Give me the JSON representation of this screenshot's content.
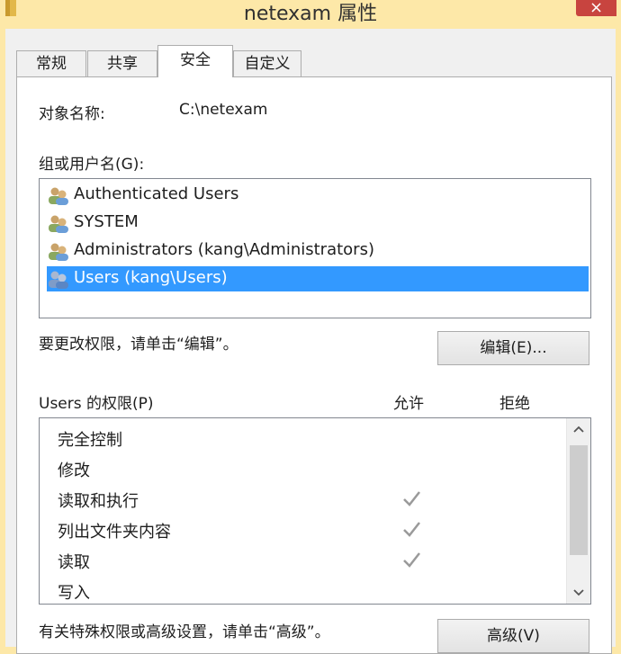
{
  "window": {
    "title": "netexam 属性",
    "close_glyph": "×"
  },
  "tabs": [
    {
      "label": "常规",
      "active": false
    },
    {
      "label": "共享",
      "active": false
    },
    {
      "label": "安全",
      "active": true
    },
    {
      "label": "自定义",
      "active": false
    }
  ],
  "object": {
    "label": "对象名称:",
    "value": "C:\\netexam"
  },
  "groups": {
    "label": "组或用户名(G):",
    "items": [
      {
        "name": "Authenticated Users",
        "selected": false
      },
      {
        "name": "SYSTEM",
        "selected": false
      },
      {
        "name": "Administrators (kang\\Administrators)",
        "selected": false
      },
      {
        "name": "Users (kang\\Users)",
        "selected": true
      }
    ]
  },
  "edit_hint": "要更改权限，请单击“编辑”。",
  "edit_button": "编辑(E)...",
  "permissions": {
    "label": "Users 的权限(P)",
    "allow_header": "允许",
    "deny_header": "拒绝",
    "items": [
      {
        "name": "完全控制",
        "allow": false,
        "deny": false
      },
      {
        "name": "修改",
        "allow": false,
        "deny": false
      },
      {
        "name": "读取和执行",
        "allow": true,
        "deny": false
      },
      {
        "name": "列出文件夹内容",
        "allow": true,
        "deny": false
      },
      {
        "name": "读取",
        "allow": true,
        "deny": false
      },
      {
        "name": "写入",
        "allow": false,
        "deny": false
      }
    ]
  },
  "advanced_hint": "有关特殊权限或高级设置，请单击“高级”。",
  "advanced_button": "高级(V)",
  "colors": {
    "selection": "#3399ff",
    "titlebar": "#fde8a8",
    "close": "#c8443f",
    "check": "#9a9a9a"
  },
  "icons": {
    "folder": "folder-icon",
    "user_group": "users-group-icon",
    "check": "check-icon",
    "scroll_up": "chevron-up-icon",
    "scroll_down": "chevron-down-icon"
  }
}
